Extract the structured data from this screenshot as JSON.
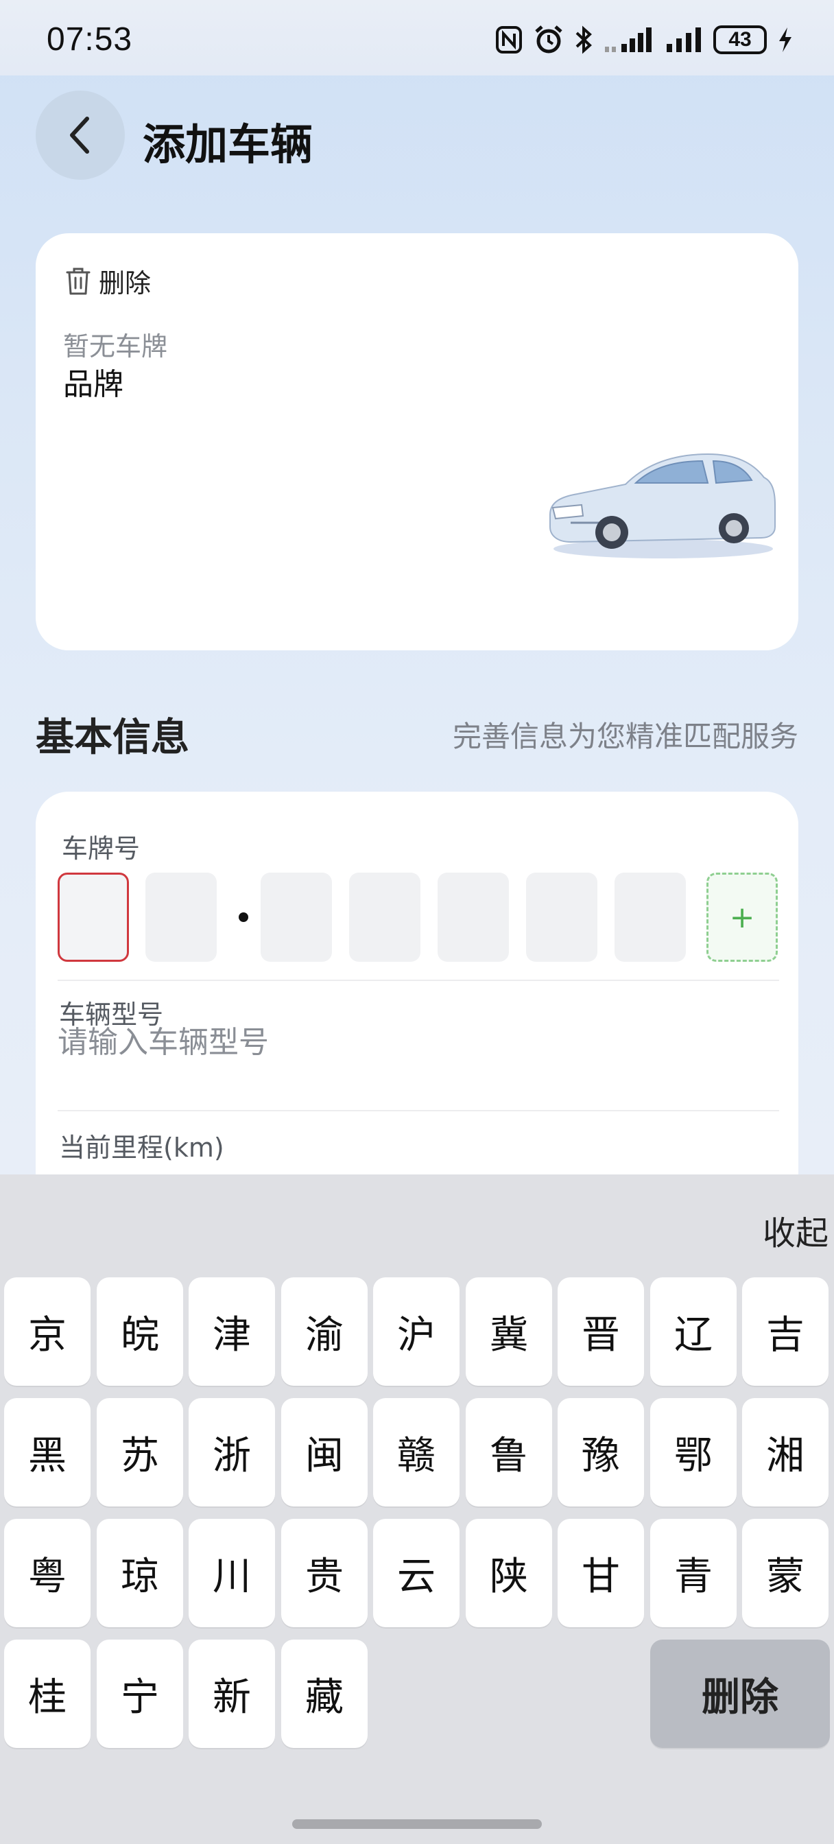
{
  "status_bar": {
    "time": "07:53",
    "battery": "43",
    "icons": [
      "nfc-icon",
      "alarm-icon",
      "bluetooth-icon",
      "signal-icon",
      "signal-icon",
      "battery-icon",
      "charging-icon"
    ]
  },
  "header": {
    "title": "添加车辆"
  },
  "car_card": {
    "delete_label": "删除",
    "plate_placeholder": "暂无车牌",
    "brand_label": "品牌"
  },
  "section": {
    "title": "基本信息",
    "subtitle": "完善信息为您精准匹配服务"
  },
  "form": {
    "plate_label": "车牌号",
    "add_symbol": "+",
    "model_label": "车辆型号",
    "model_placeholder": "请输入车辆型号",
    "mileage_label": "当前里程(km)"
  },
  "keyboard": {
    "collapse_label": "收起",
    "rows": [
      [
        "京",
        "皖",
        "津",
        "渝",
        "沪",
        "冀",
        "晋",
        "辽",
        "吉"
      ],
      [
        "黑",
        "苏",
        "浙",
        "闽",
        "赣",
        "鲁",
        "豫",
        "鄂",
        "湘"
      ],
      [
        "粤",
        "琼",
        "川",
        "贵",
        "云",
        "陕",
        "甘",
        "青",
        "蒙"
      ],
      [
        "桂",
        "宁",
        "新",
        "藏"
      ]
    ],
    "delete_label": "删除"
  }
}
